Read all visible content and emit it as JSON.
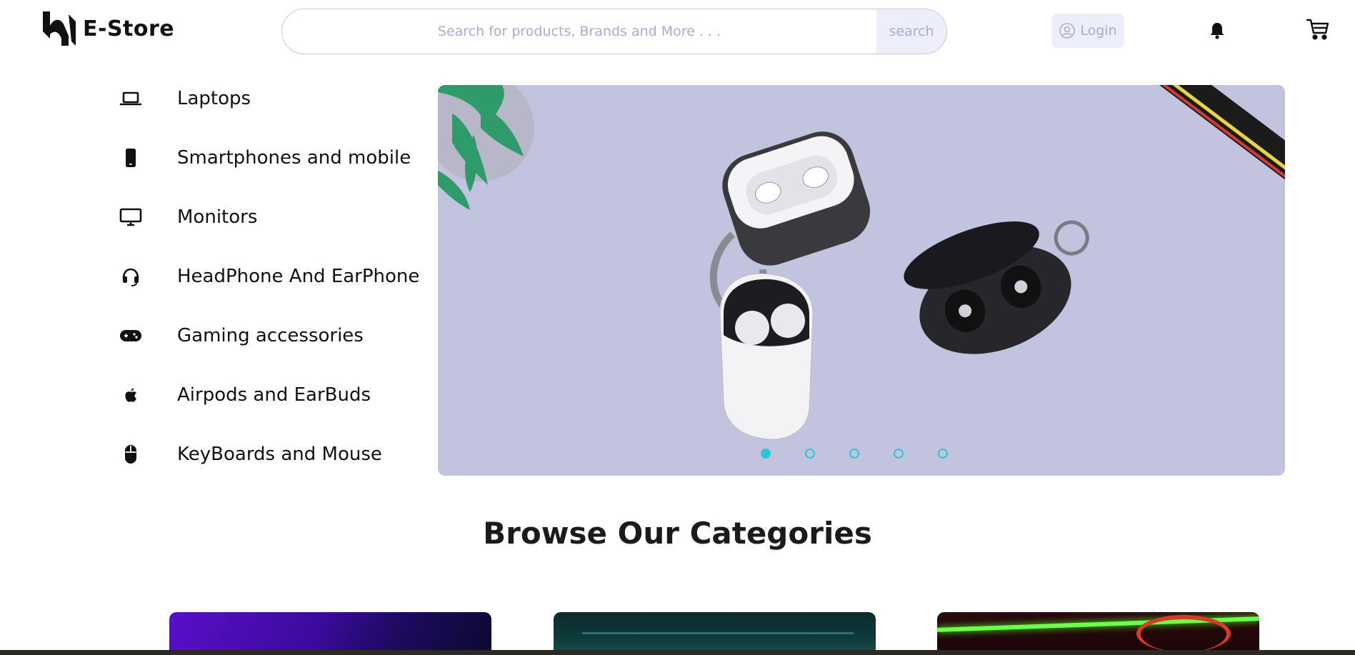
{
  "header": {
    "brand": "E-Store",
    "search_placeholder": "Search for products, Brands and More . . .",
    "search_button": "search",
    "login_label": "Login"
  },
  "sidebar": {
    "items": [
      {
        "label": "Laptops",
        "icon": "laptop-icon"
      },
      {
        "label": "Smartphones and mobile",
        "icon": "smartphone-icon"
      },
      {
        "label": "Monitors",
        "icon": "monitor-icon"
      },
      {
        "label": "HeadPhone And EarPhone",
        "icon": "headphone-icon"
      },
      {
        "label": "Gaming accessories",
        "icon": "gamepad-icon"
      },
      {
        "label": "Airpods and EarBuds",
        "icon": "apple-icon"
      },
      {
        "label": "KeyBoards and Mouse",
        "icon": "mouse-icon"
      }
    ]
  },
  "banner": {
    "slide_count": 5,
    "active_slide": 1,
    "accent_color": "#2fc4d6"
  },
  "categories_section": {
    "title": "Browse Our Categories"
  }
}
